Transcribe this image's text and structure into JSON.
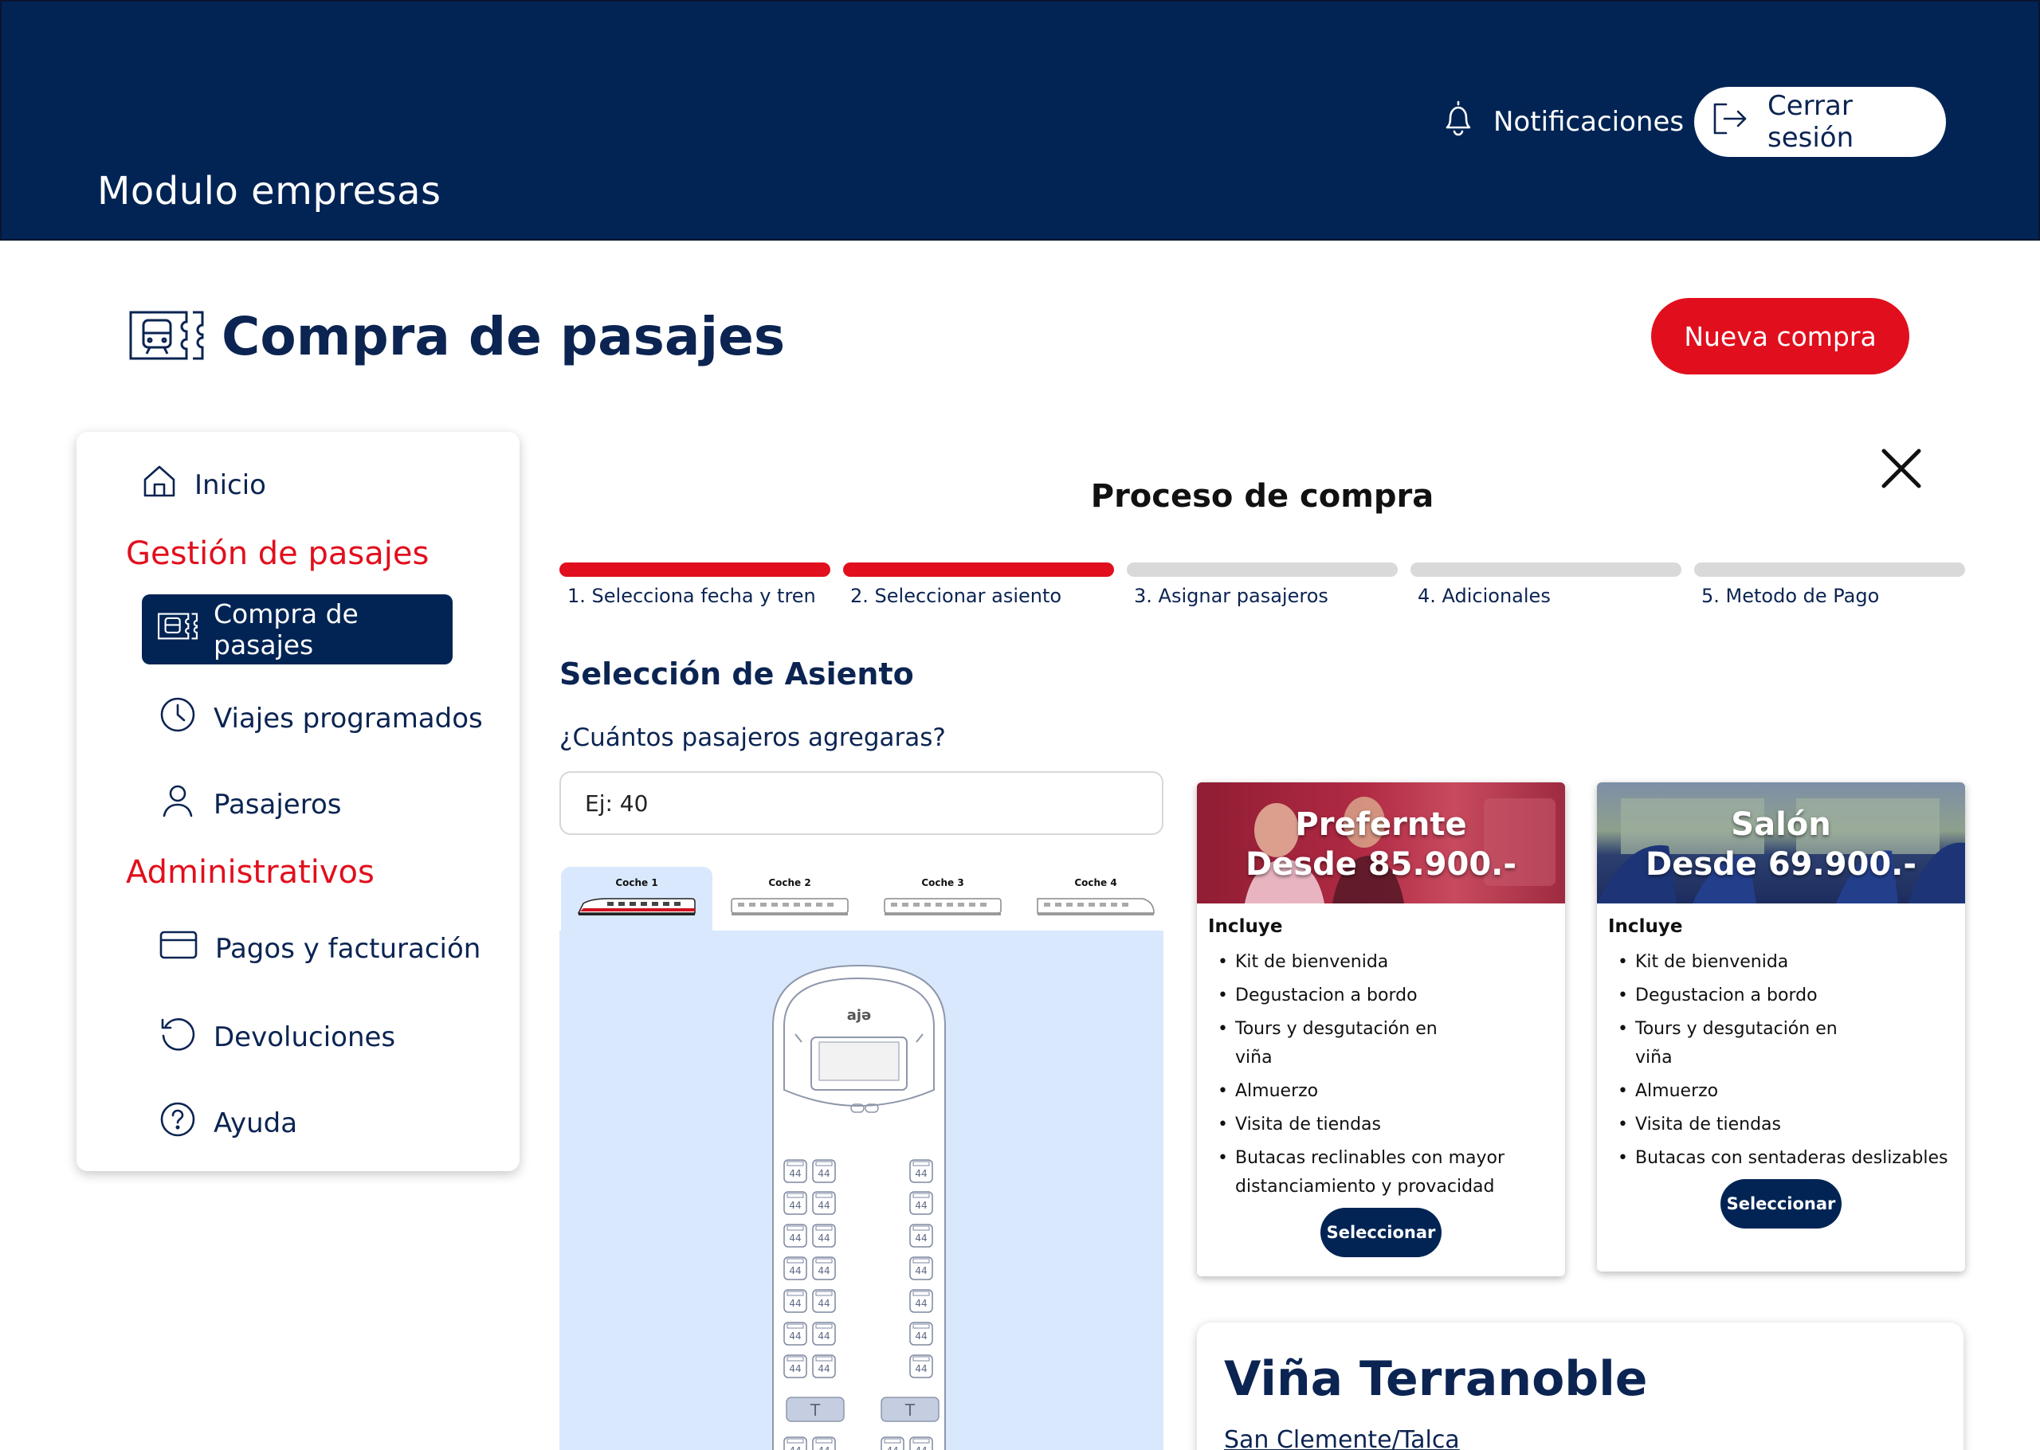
{
  "header": {
    "module_title": "Modulo empresas",
    "notifications_label": "Notificaciones",
    "logout_label": "Cerrar sesión"
  },
  "page": {
    "title": "Compra de pasajes",
    "new_purchase_label": "Nueva compra"
  },
  "sidebar": {
    "home": "Inicio",
    "section_tickets": "Gestión de pasajes",
    "items_tickets": [
      "Compra de pasajes",
      "Viajes programados",
      "Pasajeros"
    ],
    "section_admin": "Administrativos",
    "items_admin": [
      "Pagos y facturación",
      "Devoluciones",
      "Ayuda"
    ],
    "active_item": "Compra de pasajes"
  },
  "process": {
    "title": "Proceso de compra",
    "steps": [
      {
        "label": "1. Selecciona fecha y tren",
        "done": true
      },
      {
        "label": "2. Seleccionar asiento",
        "done": true
      },
      {
        "label": "3. Asignar pasajeros",
        "done": false
      },
      {
        "label": "4. Adicionales",
        "done": false
      },
      {
        "label": "5. Metodo de Pago",
        "done": false
      }
    ],
    "section_title": "Selección de Asiento",
    "passengers_question": "¿Cuántos pasajeros agregaras?",
    "passengers_placeholder": "Ej: 40"
  },
  "coaches": {
    "tabs": [
      "Coche 1",
      "Coche 2",
      "Coche 3",
      "Coche 4"
    ],
    "selected": "Coche 1",
    "seat_number": "44",
    "train_logo": "ajə"
  },
  "cards": [
    {
      "name": "Prefernte",
      "price": "Desde 85.900.-",
      "includes_label": "Incluye",
      "items": [
        "Kit de bienvenida",
        "Degustacion a bordo",
        "Tours y desgutación en viña",
        "Almuerzo",
        "Visita de tiendas",
        "Butacas reclinables con mayor distanciamiento y provacidad"
      ],
      "button": "Seleccionar"
    },
    {
      "name": "Salón",
      "price": "Desde 69.900.-",
      "includes_label": "Incluye",
      "items": [
        "Kit de bienvenida",
        "Degustacion a bordo",
        "Tours y desgutación en viña",
        "Almuerzo",
        "Visita de tiendas",
        "Butacas con sentaderas deslizables"
      ],
      "button": "Seleccionar"
    }
  ],
  "destination": {
    "title": "Viña Terranoble",
    "subtitle": "San Clemente/Talca"
  },
  "colors": {
    "navy": "#012454",
    "red": "#e10f1d",
    "step_inactive": "#d9d9d9",
    "seat_panel": "#d9e8fc"
  },
  "icons": [
    "bell-icon",
    "logout-icon",
    "ticket-train-icon",
    "home-icon",
    "clock-icon",
    "user-icon",
    "card-icon",
    "undo-icon",
    "help-icon",
    "close-icon"
  ]
}
